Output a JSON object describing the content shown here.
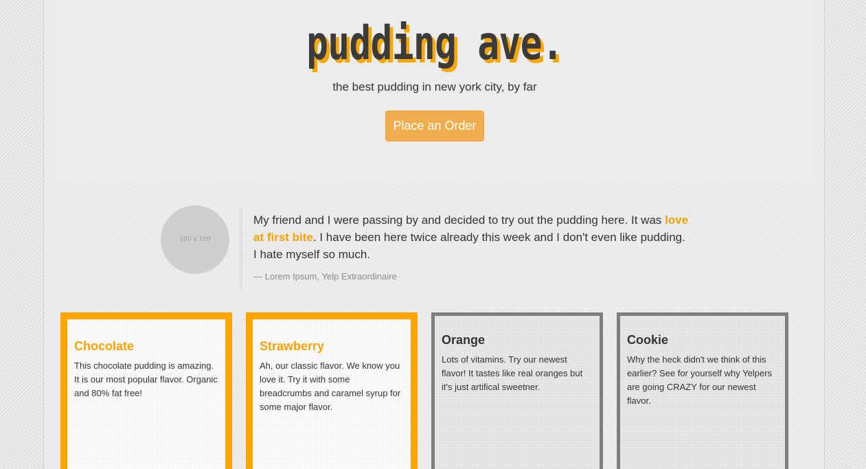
{
  "header": {
    "logo": "pudding ave.",
    "tagline": "the best pudding in new york city, by far",
    "order_button": "Place an Order"
  },
  "testimonial": {
    "avatar_placeholder": "100 x 100",
    "text_before": "My friend and I were passing by and decided to try out the pudding here. It was ",
    "highlight": "love at first bite",
    "text_after": ". I have been here twice already this week and I don't even like pudding. I hate myself so much.",
    "citation": "— Lorem Ipsum, Yelp Extraordinaire"
  },
  "flavors": [
    {
      "name": "Chocolate",
      "description": "This chocolate pudding is amazing. It is our most popular flavor. Organic and 80% fat free!"
    },
    {
      "name": "Strawberry",
      "description": "Ah, our classic flavor. We know you love it. Try it with some breadcrumbs and caramel syrup for some major flavor."
    },
    {
      "name": "Orange",
      "description": "Lots of vitamins. Try our newest flavor! It tastes like real oranges but it's just artifical sweetner."
    },
    {
      "name": "Cookie",
      "description": "Why the heck didn't we think of this earlier? See for yourself why Yelpers are going CRAZY for our newest flavor."
    }
  ],
  "colors": {
    "accent": "#ffa500",
    "button": "#f0ad4e",
    "text": "#333333",
    "card_border_plain": "#7f7f7f"
  }
}
